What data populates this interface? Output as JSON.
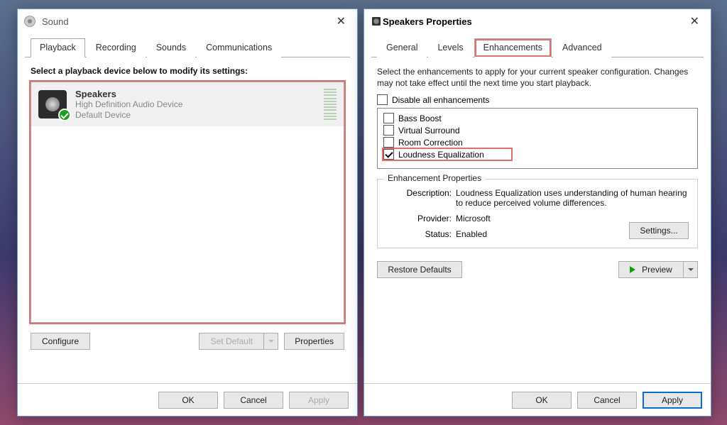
{
  "sound": {
    "title": "Sound",
    "tabs": [
      "Playback",
      "Recording",
      "Sounds",
      "Communications"
    ],
    "active_tab": 0,
    "instruction": "Select a playback device below to modify its settings:",
    "device": {
      "name": "Speakers",
      "driver": "High Definition Audio Device",
      "status": "Default Device"
    },
    "buttons": {
      "configure": "Configure",
      "set_default": "Set Default",
      "properties": "Properties"
    },
    "dialog_buttons": {
      "ok": "OK",
      "cancel": "Cancel",
      "apply": "Apply"
    }
  },
  "speakers": {
    "title": "Speakers Properties",
    "tabs": [
      "General",
      "Levels",
      "Enhancements",
      "Advanced"
    ],
    "active_tab": 2,
    "intro": "Select the enhancements to apply for your current speaker configuration. Changes may not take effect until the next time you start playback.",
    "disable_all": {
      "label": "Disable all enhancements",
      "checked": false
    },
    "enhancements": [
      {
        "label": "Bass Boost",
        "checked": false
      },
      {
        "label": "Virtual Surround",
        "checked": false
      },
      {
        "label": "Room Correction",
        "checked": false
      },
      {
        "label": "Loudness Equalization",
        "checked": true
      }
    ],
    "props": {
      "legend": "Enhancement Properties",
      "desc_label": "Description:",
      "description": "Loudness Equalization uses understanding of human hearing to reduce perceived volume differences.",
      "provider_label": "Provider:",
      "provider": "Microsoft",
      "status_label": "Status:",
      "status": "Enabled",
      "settings": "Settings..."
    },
    "lower": {
      "restore": "Restore Defaults",
      "preview": "Preview"
    },
    "dialog_buttons": {
      "ok": "OK",
      "cancel": "Cancel",
      "apply": "Apply"
    }
  }
}
